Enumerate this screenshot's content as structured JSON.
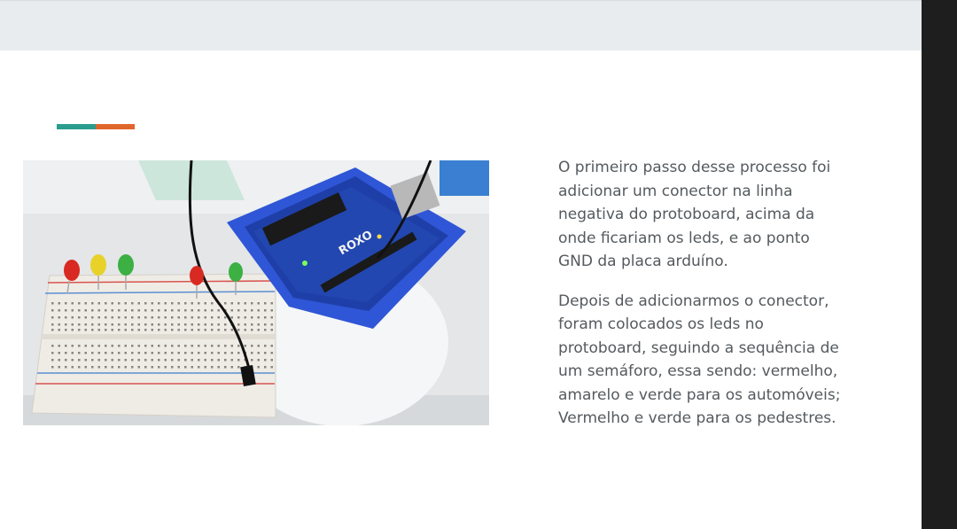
{
  "slide": {
    "paragraphs": [
      "O primeiro passo desse processo foi\nadicionar um conector na linha\nnegativa do protoboard, acima da\nonde ficariam os leds, e ao ponto\nGND da placa arduíno.",
      "Depois de adicionarmos o conector,\nforam colocados os leds no\nprotoboard, seguindo a sequência de\num semáforo, essa sendo: vermelho,\namarelo e verde para os automóveis;\nVermelho e verde  para os pedestres."
    ],
    "photo_board_label": "ROXO"
  },
  "colors": {
    "accent_teal": "#2a9d8f",
    "accent_orange": "#e0672b",
    "top_band": "#e8ecee",
    "right_rail": "#1e1e1e",
    "text": "#555a5e",
    "arduino_blue": "#2f56d6"
  }
}
